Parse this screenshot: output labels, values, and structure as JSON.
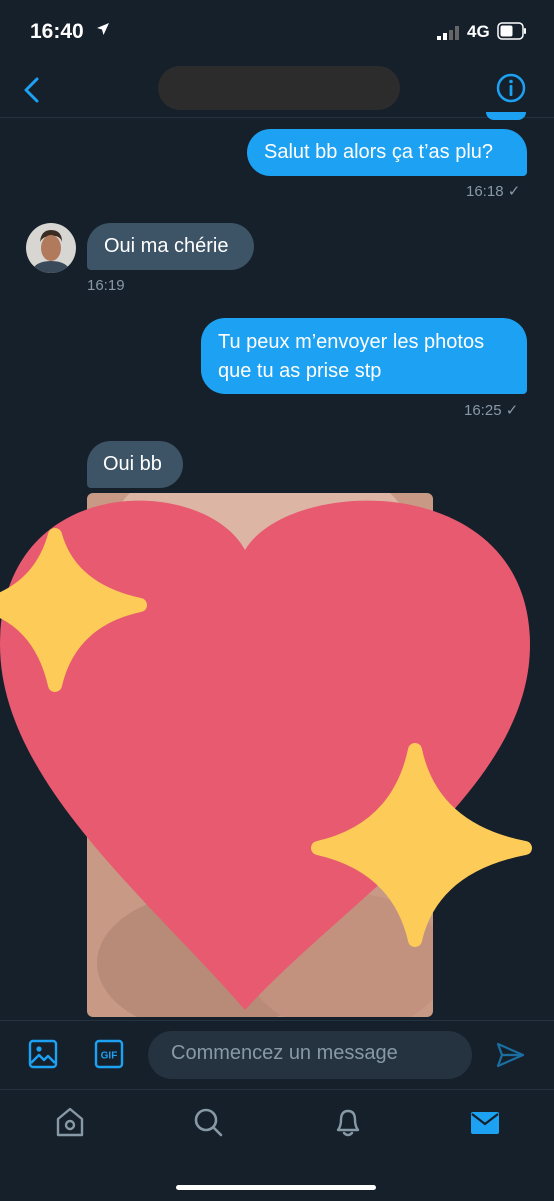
{
  "status_bar": {
    "time": "16:40",
    "network": "4G"
  },
  "header": {
    "back_icon": "chevron-left-icon",
    "info_icon": "info-icon"
  },
  "messages": [
    {
      "direction": "out",
      "text": "Salut bb alors ça t’as plu?",
      "time": "16:18"
    },
    {
      "direction": "in",
      "text": "Oui ma chérie",
      "time": "16:19"
    },
    {
      "direction": "out",
      "lines": [
        "Tu peux m’envoyer les photos",
        "que tu as prise stp"
      ],
      "time": "16:25"
    },
    {
      "direction": "in",
      "text": "Oui bb"
    }
  ],
  "read_mark": "✓",
  "compose": {
    "placeholder": "Commencez un message",
    "gif_label": "GIF"
  },
  "tabs": [
    "home-icon",
    "search-icon",
    "bell-icon",
    "mail-icon"
  ],
  "colors": {
    "background": "#15202b",
    "accent": "#1da1f2",
    "incoming": "#3d5466",
    "muted": "#8899a6",
    "heart": "#e75a70",
    "sparkle": "#fdcb58"
  }
}
